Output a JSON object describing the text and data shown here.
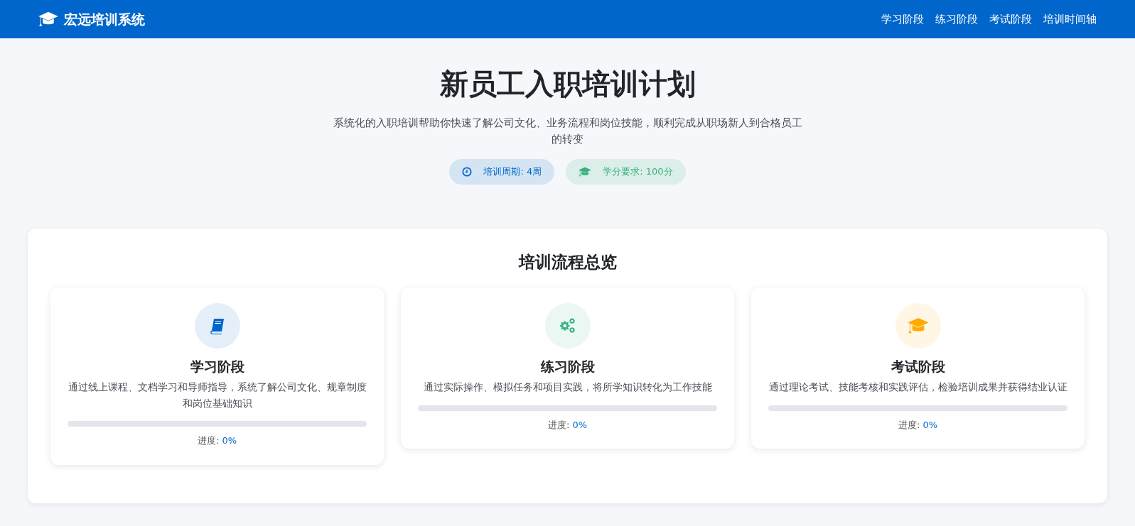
{
  "navbar": {
    "brand": "宏远培训系统",
    "links": [
      "学习阶段",
      "练习阶段",
      "考试阶段",
      "培训时间轴"
    ]
  },
  "hero": {
    "title": "新员工入职培训计划",
    "subtitle": "系统化的入职培训帮助你快速了解公司文化、业务流程和岗位技能，顺利完成从职场新人到合格员工的转变",
    "badges": [
      {
        "kind": "clock",
        "label": "培训周期: 4周",
        "color": "#0066cc"
      },
      {
        "kind": "cap",
        "label": "学分要求: 100分",
        "color": "#36b37e"
      }
    ]
  },
  "overview": {
    "title": "培训流程总览",
    "stages": [
      {
        "kind": "book",
        "title": "学习阶段",
        "description": "通过线上课程、文档学习和导师指导，系统了解公司文化、规章制度和岗位基础知识",
        "progress_label": "进度:",
        "progress_value": "0%",
        "level": 0,
        "color": "#0066cc"
      },
      {
        "kind": "gears",
        "title": "练习阶段",
        "description": "通过实际操作、模拟任务和项目实践，将所学知识转化为工作技能",
        "progress_label": "进度:",
        "progress_value": "0%",
        "level": 0,
        "color": "#36b37e"
      },
      {
        "kind": "cap",
        "title": "考试阶段",
        "description": "通过理论考试、技能考核和实践评估，检验培训成果并获得结业认证",
        "progress_label": "进度:",
        "progress_value": "0%",
        "level": 0,
        "color": "#ffab00"
      }
    ]
  }
}
